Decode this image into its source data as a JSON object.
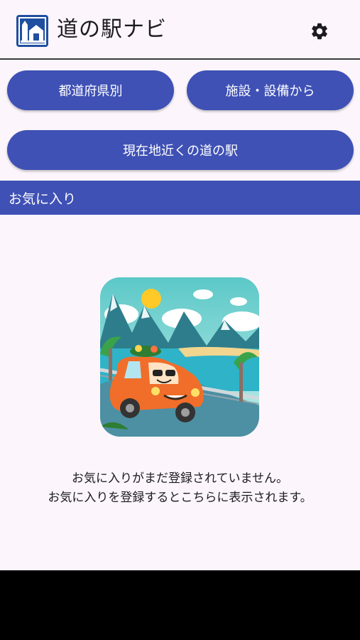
{
  "app_bar": {
    "title": "道の駅ナビ",
    "logo_icon": "roadside-station-logo-icon",
    "settings_icon": "gear-icon"
  },
  "buttons": {
    "by_prefecture": "都道府県別",
    "by_facility": "施設・設備から",
    "nearby": "現在地近くの道の駅"
  },
  "favorites": {
    "header": "お気に入り",
    "empty_line1": "お気に入りがまだ登録されていません。",
    "empty_line2": "お気に入りを登録するとこちらに表示されます。",
    "illustration": "car-by-sea-illustration"
  },
  "colors": {
    "primary": "#3f51b5",
    "background": "#fcf6fc",
    "logo": "#1f4fa0"
  }
}
